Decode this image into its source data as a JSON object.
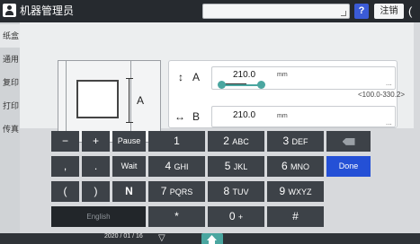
{
  "header": {
    "title": "机器管理员",
    "help_label": "?",
    "logout_label": "注销",
    "edge_icon": "("
  },
  "sidebar": {
    "items": [
      {
        "label": "纸盒"
      },
      {
        "label": "通用"
      },
      {
        "label": "复印"
      },
      {
        "label": "打印"
      },
      {
        "label": "传真"
      }
    ]
  },
  "main": {
    "paper_diagram_letter": "A",
    "field_a": {
      "letter": "A",
      "icon": "↕",
      "value": "210.0",
      "unit": "mm",
      "range": "<100.0-330.2>",
      "more": "..."
    },
    "field_b": {
      "letter": "B",
      "icon": "↔",
      "value": "210.0",
      "unit": "mm",
      "more": "..."
    }
  },
  "keyboard": {
    "minus": "−",
    "plus": "+",
    "pause": "Pause",
    "comma": ",",
    "period": ".",
    "wait": "Wait",
    "paren_open": "(",
    "paren_close": ")",
    "n": "N",
    "english": "English",
    "k1": "1",
    "k2": "2",
    "k2_sub": "ABC",
    "k3": "3",
    "k3_sub": "DEF",
    "k4": "4",
    "k4_sub": "GHI",
    "k5": "5",
    "k5_sub": "JKL",
    "k6": "6",
    "k6_sub": "MNO",
    "k7": "7",
    "k7_sub": "PQRS",
    "k8": "8",
    "k8_sub": "TUV",
    "k9": "9",
    "k9_sub": "WXYZ",
    "star": "*",
    "k0": "0",
    "k0_sub": "+",
    "hash": "#",
    "done": "Done",
    "backspace_icon": "backspace-icon"
  },
  "footer": {
    "date": "2020 / 01 / 16",
    "down_icon": "▽",
    "home_icon": "home-icon"
  },
  "colors": {
    "accent_teal": "#4aa6a0",
    "done_blue": "#2450d6",
    "help_blue": "#3b5bd6",
    "topbar": "#262a2f",
    "key": "#3d4248"
  }
}
